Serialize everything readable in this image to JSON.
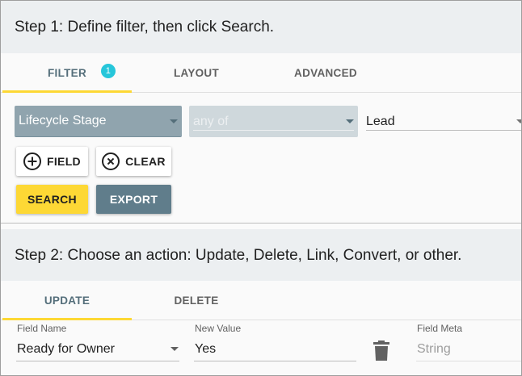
{
  "step1": {
    "title": "Step 1: Define filter, then click Search.",
    "tabs": [
      {
        "label": "FILTER",
        "badge": "1",
        "active": true
      },
      {
        "label": "LAYOUT",
        "active": false
      },
      {
        "label": "ADVANCED",
        "active": false
      }
    ],
    "filter": {
      "field_select": "Lifecycle Stage",
      "operator_select": "any of",
      "value_select": "Lead"
    },
    "buttons": {
      "field": "FIELD",
      "clear": "CLEAR",
      "search": "SEARCH",
      "export": "EXPORT"
    }
  },
  "step2": {
    "title": "Step 2: Choose an action: Update, Delete, Link, Convert, or other.",
    "tabs": [
      {
        "label": "UPDATE",
        "active": true
      },
      {
        "label": "DELETE",
        "active": false
      }
    ],
    "row": {
      "field_name_label": "Field Name",
      "field_name_value": "Ready for Owner",
      "new_value_label": "New Value",
      "new_value_value": "Yes",
      "field_meta_label": "Field Meta",
      "field_meta_value": "String"
    }
  },
  "colors": {
    "accent_yellow": "#fdd835",
    "slate": "#607d8b",
    "badge": "#26c6da",
    "header_bg": "#eceff1"
  },
  "icons": [
    "plus-circle-icon",
    "close-circle-icon",
    "trash-icon",
    "dropdown-caret-icon"
  ]
}
